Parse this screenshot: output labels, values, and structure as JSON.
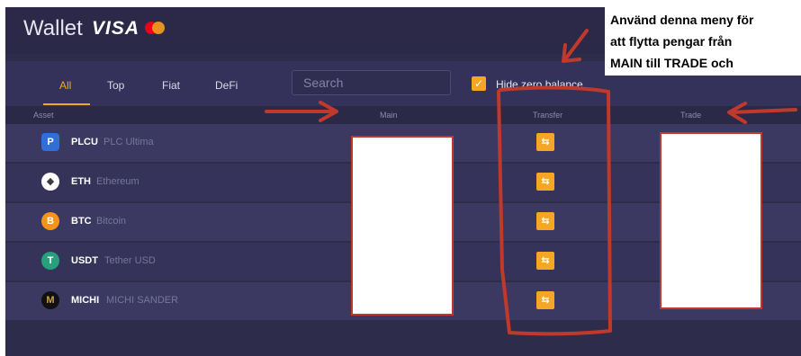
{
  "header": {
    "title": "Wallet",
    "visa": "VISA"
  },
  "tabs": [
    {
      "label": "All",
      "active": true
    },
    {
      "label": "Top"
    },
    {
      "label": "Fiat"
    },
    {
      "label": "DeFi"
    }
  ],
  "search": {
    "placeholder": "Search",
    "value": ""
  },
  "hide_zero": {
    "checked": true,
    "label": "Hide zero balance"
  },
  "columns": {
    "asset": "Asset",
    "main": "Main",
    "transfer": "Transfer",
    "trade": "Trade"
  },
  "assets": [
    {
      "symbol": "PLCU",
      "name": "PLC Ultima",
      "icon": "plcu-icon",
      "icon_color": "#2f6fd6",
      "glyph": "P"
    },
    {
      "symbol": "ETH",
      "name": "Ethereum",
      "icon": "eth-icon",
      "icon_color": "#ffffff",
      "glyph": "◆"
    },
    {
      "symbol": "BTC",
      "name": "Bitcoin",
      "icon": "btc-icon",
      "icon_color": "#f7931a",
      "glyph": "B"
    },
    {
      "symbol": "USDT",
      "name": "Tether USD",
      "icon": "usdt-icon",
      "icon_color": "#26a17b",
      "glyph": "T"
    },
    {
      "symbol": "MICHI",
      "name": "MICHI SANDER",
      "icon": "michi-icon",
      "icon_color": "#111111",
      "glyph": "M"
    }
  ],
  "transfer_icon": "⇆",
  "annotation": {
    "lines": [
      "Använd denna meny för",
      "att flytta pengar från",
      "MAIN till TRADE och"
    ]
  },
  "colors": {
    "accent": "#f5a623",
    "background": "#2e2c4b",
    "annotation_red": "#c0392b"
  }
}
